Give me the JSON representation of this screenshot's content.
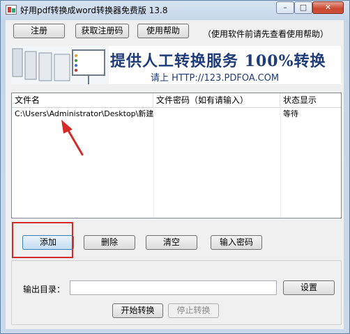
{
  "window": {
    "title": "好用pdf转换成word转换器免费版 13.8",
    "minimize_label": "–",
    "maximize_label": "□",
    "close_label": "✕"
  },
  "toolbar": {
    "register_label": "注册",
    "get_code_label": "获取注册码",
    "help_label": "使用帮助",
    "hint": "（使用软件前请先查看使用帮助）"
  },
  "banner": {
    "main_text": "提供人工转换服务 100%转换",
    "sub_text": "请上  HTTP://123.PDFOA.COM"
  },
  "file_list": {
    "columns": [
      "文件名",
      "文件密码（如有请输入）",
      "状态显示"
    ],
    "rows": [
      {
        "name": "C:\\Users\\Administrator\\Desktop\\新建...",
        "password": "",
        "status": "等待"
      }
    ]
  },
  "actions": {
    "add_label": "添加",
    "delete_label": "删除",
    "clear_label": "清空",
    "password_label": "输入密码"
  },
  "output": {
    "label": "输出目录：",
    "value": "",
    "settings_label": "设置",
    "start_label": "开始转换",
    "stop_label": "停止转换"
  },
  "colors": {
    "annotation": "#d42a2a",
    "banner_text": "#1f3c7a"
  }
}
